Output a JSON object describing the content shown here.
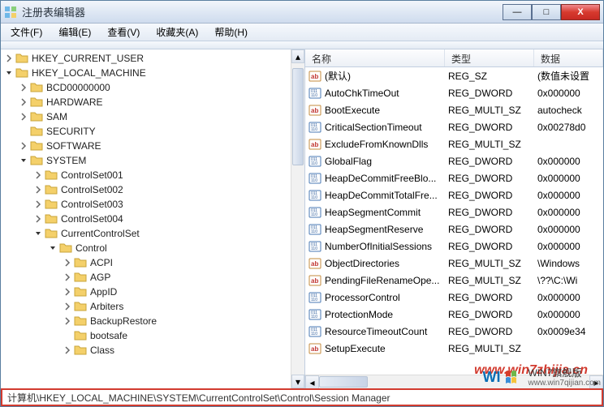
{
  "window": {
    "title": "注册表编辑器"
  },
  "menu": {
    "file": "文件(F)",
    "edit": "编辑(E)",
    "view": "查看(V)",
    "favorites": "收藏夹(A)",
    "help": "帮助(H)"
  },
  "tree": {
    "hkcu": "HKEY_CURRENT_USER",
    "hklm": "HKEY_LOCAL_MACHINE",
    "bcd": "BCD00000000",
    "hardware": "HARDWARE",
    "sam": "SAM",
    "security": "SECURITY",
    "software": "SOFTWARE",
    "system": "SYSTEM",
    "cs001": "ControlSet001",
    "cs002": "ControlSet002",
    "cs003": "ControlSet003",
    "cs004": "ControlSet004",
    "ccs": "CurrentControlSet",
    "control": "Control",
    "acpi": "ACPI",
    "agp": "AGP",
    "appid": "AppID",
    "arbiters": "Arbiters",
    "backuprestore": "BackupRestore",
    "bootsafe": "bootsafe",
    "class": "Class"
  },
  "list": {
    "headers": {
      "name": "名称",
      "type": "类型",
      "data": "数据"
    },
    "rows": [
      {
        "kind": "sz",
        "name": "(默认)",
        "type": "REG_SZ",
        "data": "(数值未设置"
      },
      {
        "kind": "dw",
        "name": "AutoChkTimeOut",
        "type": "REG_DWORD",
        "data": "0x000000"
      },
      {
        "kind": "multi",
        "name": "BootExecute",
        "type": "REG_MULTI_SZ",
        "data": "autocheck"
      },
      {
        "kind": "dw",
        "name": "CriticalSectionTimeout",
        "type": "REG_DWORD",
        "data": "0x00278d0"
      },
      {
        "kind": "multi",
        "name": "ExcludeFromKnownDlls",
        "type": "REG_MULTI_SZ",
        "data": ""
      },
      {
        "kind": "dw",
        "name": "GlobalFlag",
        "type": "REG_DWORD",
        "data": "0x000000"
      },
      {
        "kind": "dw",
        "name": "HeapDeCommitFreeBlo...",
        "type": "REG_DWORD",
        "data": "0x000000"
      },
      {
        "kind": "dw",
        "name": "HeapDeCommitTotalFre...",
        "type": "REG_DWORD",
        "data": "0x000000"
      },
      {
        "kind": "dw",
        "name": "HeapSegmentCommit",
        "type": "REG_DWORD",
        "data": "0x000000"
      },
      {
        "kind": "dw",
        "name": "HeapSegmentReserve",
        "type": "REG_DWORD",
        "data": "0x000000"
      },
      {
        "kind": "dw",
        "name": "NumberOfInitialSessions",
        "type": "REG_DWORD",
        "data": "0x000000"
      },
      {
        "kind": "multi",
        "name": "ObjectDirectories",
        "type": "REG_MULTI_SZ",
        "data": "\\Windows"
      },
      {
        "kind": "multi",
        "name": "PendingFileRenameOpe...",
        "type": "REG_MULTI_SZ",
        "data": "\\??\\C:\\Wi"
      },
      {
        "kind": "dw",
        "name": "ProcessorControl",
        "type": "REG_DWORD",
        "data": "0x000000"
      },
      {
        "kind": "dw",
        "name": "ProtectionMode",
        "type": "REG_DWORD",
        "data": "0x000000"
      },
      {
        "kind": "dw",
        "name": "ResourceTimeoutCount",
        "type": "REG_DWORD",
        "data": "0x0009e34"
      },
      {
        "kind": "multi",
        "name": "SetupExecute",
        "type": "REG_MULTI_SZ",
        "data": ""
      }
    ]
  },
  "statusbar": "计算机\\HKEY_LOCAL_MACHINE\\SYSTEM\\CurrentControlSet\\Control\\Session Manager",
  "watermark": "www.win7zhijia.cn",
  "footer": {
    "brand": "WI",
    "sub": "WIN7旗舰版",
    "sub2": "www.win7qijian.com"
  }
}
